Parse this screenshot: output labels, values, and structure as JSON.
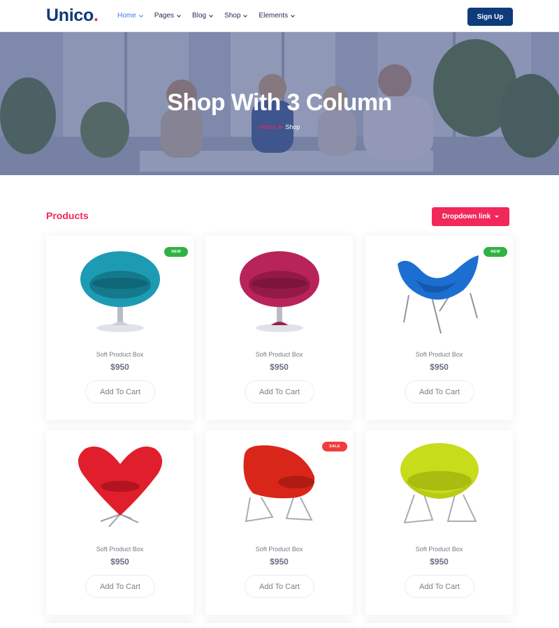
{
  "header": {
    "logo_text": "Unico",
    "logo_dot": ".",
    "nav": [
      {
        "label": "Home",
        "active": true
      },
      {
        "label": "Pages",
        "active": false
      },
      {
        "label": "Blog",
        "active": false
      },
      {
        "label": "Shop",
        "active": false
      },
      {
        "label": "Elements",
        "active": false
      }
    ],
    "signup_label": "Sign Up"
  },
  "hero": {
    "title": "Shop With 3 Column",
    "breadcrumb_home": "Home",
    "breadcrumb_current": "Shop"
  },
  "products": {
    "title": "Products",
    "dropdown_label": "Dropdown link",
    "items": [
      {
        "name": "Soft Product Box",
        "price": "$950",
        "cart_label": "Add To Cart",
        "badge": "NEW",
        "color": "#1d9bb3",
        "style": "egg-chair"
      },
      {
        "name": "Soft Product Box",
        "price": "$950",
        "cart_label": "Add To Cart",
        "badge": "",
        "color": "#b8245a",
        "style": "egg-chair"
      },
      {
        "name": "Soft Product Box",
        "price": "$950",
        "cart_label": "Add To Cart",
        "badge": "NEW",
        "color": "#1c6fd1",
        "style": "petal-chair"
      },
      {
        "name": "Soft Product Box",
        "price": "$950",
        "cart_label": "Add To Cart",
        "badge": "",
        "color": "#e11f2c",
        "style": "heart-chair"
      },
      {
        "name": "Soft Product Box",
        "price": "$950",
        "cart_label": "Add To Cart",
        "badge": "SALE",
        "color": "#d9261a",
        "style": "lounge-chair"
      },
      {
        "name": "Soft Product Box",
        "price": "$950",
        "cart_label": "Add To Cart",
        "badge": "",
        "color": "#c7dc1a",
        "style": "lounge-chair"
      }
    ]
  },
  "colors": {
    "brand": "#0e3b7a",
    "accent": "#f2285a",
    "badge_new": "#2fb144",
    "badge_sale": "#f23c3c"
  }
}
